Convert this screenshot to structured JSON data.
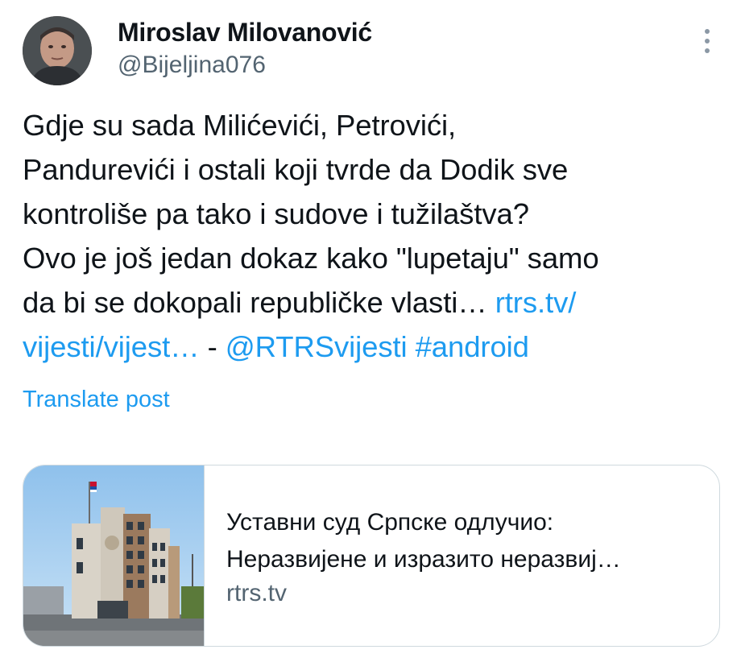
{
  "author": {
    "name": "Miroslav Milovanović",
    "handle": "@Bijeljina076"
  },
  "post": {
    "text_part1": "Gdje su sada Milićevići, Petrovići,\nPandurevići i ostali koji tvrde da Dodik sve\nkontroliše pa tako i sudove i tužilaštva?\nOvo je još jedan dokaz kako \"lupetaju\" samo\nda bi se dokopali republičke vlasti… ",
    "link_text_line1": "rtrs.tv/",
    "link_text_line2": "vijesti/vijest…",
    "separator": " - ",
    "mention": "@RTRSvijesti",
    "hashtag": "#android"
  },
  "translate_label": "Translate post",
  "link_card": {
    "title_line1": "Уставни суд Српске одлучио:",
    "title_line2": "Неразвијене и изразито неразвиј…",
    "domain": "rtrs.tv"
  },
  "colors": {
    "link": "#1d9bf0",
    "secondary_text": "#536471",
    "border": "#cfd9de"
  },
  "icons": {
    "more": "more-vertical-icon"
  }
}
